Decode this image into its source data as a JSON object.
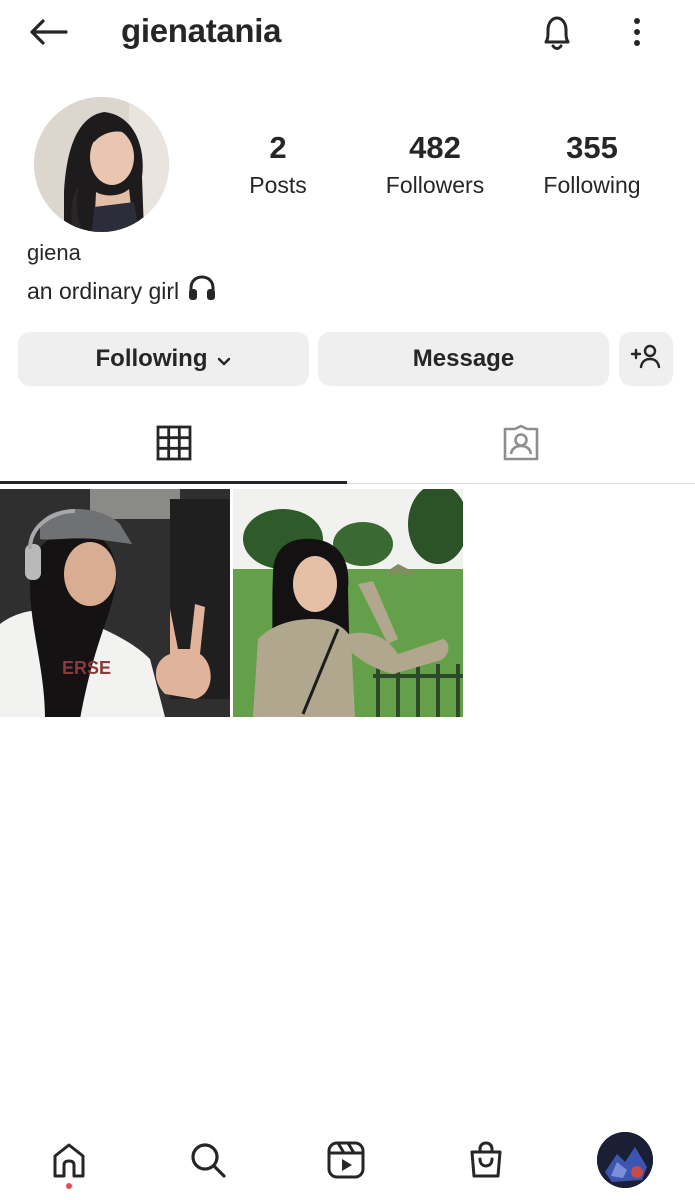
{
  "header": {
    "username": "gienatania",
    "icons": [
      "back-arrow-icon",
      "bell-icon",
      "more-vertical-icon"
    ]
  },
  "profile": {
    "stats": {
      "posts_count": "2",
      "posts_label": "Posts",
      "followers_count": "482",
      "followers_label": "Followers",
      "following_count": "355",
      "following_label": "Following"
    },
    "display_name": "giena",
    "bio": "an ordinary girl"
  },
  "actions": {
    "following_label": "Following",
    "message_label": "Message"
  },
  "tabs": {
    "active": "posts-grid",
    "items": [
      "grid-icon",
      "tagged-icon"
    ]
  },
  "posts": [
    {
      "alt": "selfie in car with cap and headphones, peace sign"
    },
    {
      "alt": "portrait in park with long hair, beige top"
    }
  ],
  "bottom_nav": {
    "items": [
      "home-icon",
      "search-icon",
      "reels-icon",
      "shop-icon",
      "profile-avatar"
    ],
    "notification_dot_color": "#ed4956"
  }
}
